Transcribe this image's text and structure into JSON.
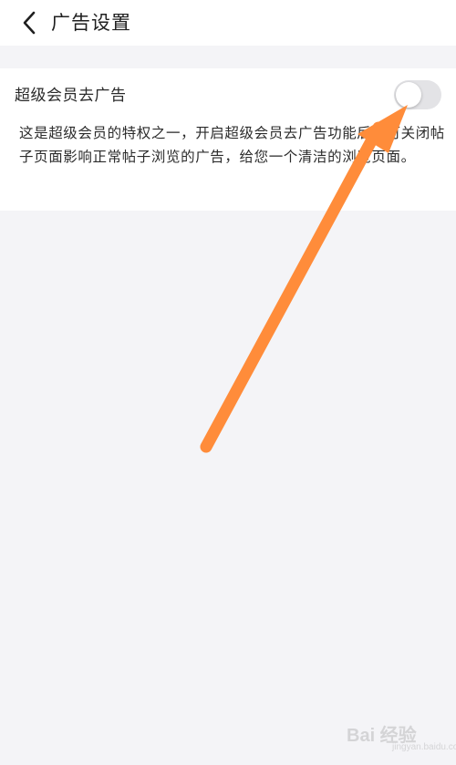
{
  "header": {
    "back_icon": "chevron-left-icon",
    "title": "广告设置"
  },
  "setting": {
    "label": "超级会员去广告",
    "toggle_state": "off",
    "description": "这是超级会员的特权之一，开启超级会员去广告功能后，可关闭帖子页面影响正常帖子浏览的广告，给您一个清洁的浏览页面。"
  },
  "annotation": {
    "arrow_color": "#ff8c3a"
  },
  "watermark": {
    "text": "Bai 经验",
    "sub": "jingyan.baidu.com"
  }
}
